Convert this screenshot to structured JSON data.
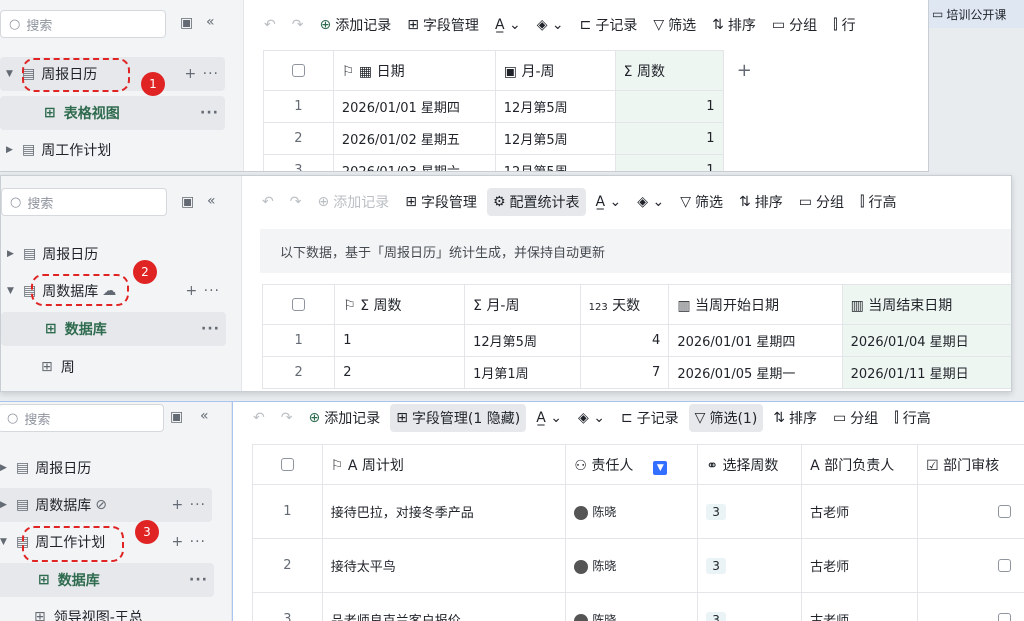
{
  "top_right": {
    "label": "培训公开课"
  },
  "p1": {
    "search": "搜索",
    "nav": [
      {
        "label": "周报日历"
      },
      {
        "label": "表格视图"
      },
      {
        "label": "周工作计划"
      }
    ],
    "badge": "1",
    "toolbar": {
      "add": "添加记录",
      "fields": "字段管理",
      "sub": "子记录",
      "filter": "筛选",
      "sort": "排序",
      "group": "分组",
      "rowh": "行"
    },
    "headers": [
      "日期",
      "月-周",
      "周数"
    ],
    "rows": [
      {
        "n": "1",
        "date": "2026/01/01 星期四",
        "mw": "12月第5周",
        "wk": "1"
      },
      {
        "n": "2",
        "date": "2026/01/02 星期五",
        "mw": "12月第5周",
        "wk": "1"
      },
      {
        "n": "3",
        "date": "2026/01/03 星期六",
        "mw": "12月第5周",
        "wk": "1"
      }
    ]
  },
  "p2": {
    "search": "搜索",
    "nav": [
      {
        "label": "周报日历"
      },
      {
        "label": "周数据库"
      },
      {
        "label": "数据库"
      },
      {
        "label": "周"
      }
    ],
    "badge": "2",
    "toolbar": {
      "add": "添加记录",
      "fields": "字段管理",
      "config": "配置统计表",
      "filter": "筛选",
      "sort": "排序",
      "group": "分组",
      "rowh": "行高"
    },
    "info": "以下数据，基于「周报日历」统计生成，并保持自动更新",
    "headers": [
      "周数",
      "月-周",
      "天数",
      "当周开始日期",
      "当周结束日期"
    ],
    "rows": [
      {
        "n": "1",
        "wk": "1",
        "mw": "12月第5周",
        "days": "4",
        "start": "2026/01/01 星期四",
        "end": "2026/01/04 星期日"
      },
      {
        "n": "2",
        "wk": "2",
        "mw": "1月第1周",
        "days": "7",
        "start": "2026/01/05 星期一",
        "end": "2026/01/11 星期日"
      }
    ]
  },
  "p3": {
    "search": "搜索",
    "nav": [
      {
        "label": "周报日历"
      },
      {
        "label": "周数据库"
      },
      {
        "label": "周工作计划"
      },
      {
        "label": "数据库"
      },
      {
        "label": "领导视图-王总"
      }
    ],
    "badge": "3",
    "toolbar": {
      "add": "添加记录",
      "fields": "字段管理(1 隐藏)",
      "sub": "子记录",
      "filter": "筛选(1)",
      "sort": "排序",
      "group": "分组",
      "rowh": "行高"
    },
    "headers": [
      "周计划",
      "责任人",
      "选择周数",
      "部门负责人",
      "部门审核"
    ],
    "rows": [
      {
        "n": "1",
        "plan": "接待巴拉，对接冬季产品",
        "owner": "陈晓",
        "wk": "3",
        "head": "古老师"
      },
      {
        "n": "2",
        "plan": "接待太平鸟",
        "owner": "陈晓",
        "wk": "3",
        "head": "古老师"
      },
      {
        "n": "3",
        "plan": "品老师良克兰客户报价",
        "owner": "陈晓",
        "wk": "3",
        "head": "古老师"
      }
    ]
  }
}
